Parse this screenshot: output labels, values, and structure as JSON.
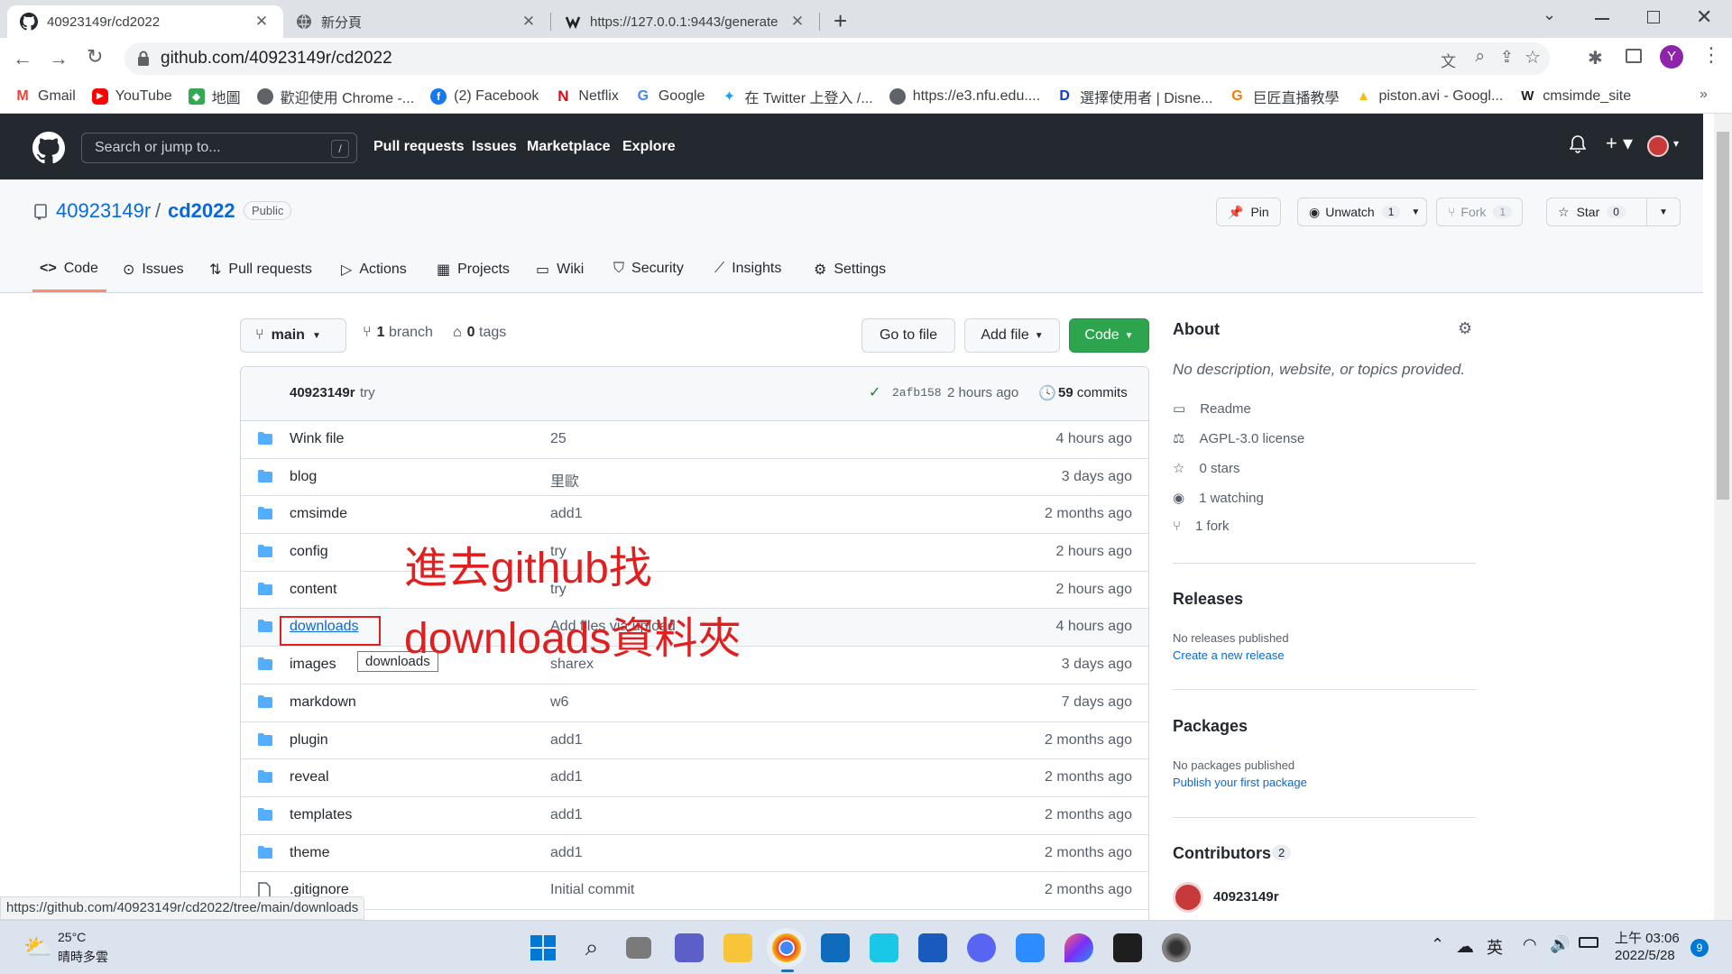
{
  "browser": {
    "tabs": [
      {
        "title": "40923149r/cd2022",
        "active": true
      },
      {
        "title": "新分頁",
        "active": false
      },
      {
        "title": "https://127.0.0.1:9443/generate",
        "active": false
      }
    ],
    "url": "github.com/40923149r/cd2022",
    "profile_initial": "Y",
    "bookmarks": [
      {
        "label": "Gmail",
        "icon": "gmail-icon",
        "color": "#ea4335"
      },
      {
        "label": "YouTube",
        "icon": "youtube-icon",
        "color": "#ff0000"
      },
      {
        "label": "地圖",
        "icon": "maps-icon",
        "color": "#34a853"
      },
      {
        "label": "歡迎使用 Chrome -...",
        "icon": "globe-icon",
        "color": "#5f6368"
      },
      {
        "label": "(2) Facebook",
        "icon": "facebook-icon",
        "color": "#1877f2"
      },
      {
        "label": "Netflix",
        "icon": "netflix-icon",
        "color": "#e50914"
      },
      {
        "label": "Google",
        "icon": "google-icon",
        "color": "#4285f4"
      },
      {
        "label": "在 Twitter 上登入 /...",
        "icon": "twitter-icon",
        "color": "#1da1f2"
      },
      {
        "label": "https://e3.nfu.edu....",
        "icon": "globe-icon",
        "color": "#5f6368"
      },
      {
        "label": "選擇使用者 | Disne...",
        "icon": "disney-icon",
        "color": "#113ccf"
      },
      {
        "label": "巨匠直播教學",
        "icon": "orange-g-icon",
        "color": "#f57c00"
      },
      {
        "label": "piston.avi - Googl...",
        "icon": "drive-icon",
        "color": "#fbbc04"
      },
      {
        "label": "cmsimde_site",
        "icon": "site-icon",
        "color": "#202124"
      }
    ],
    "status_url": "https://github.com/40923149r/cd2022/tree/main/downloads"
  },
  "github": {
    "search_placeholder": "Search or jump to...",
    "search_shortcut": "/",
    "nav": [
      "Pull requests",
      "Issues",
      "Marketplace",
      "Explore"
    ]
  },
  "repo": {
    "owner": "40923149r",
    "separator": "/",
    "name": "cd2022",
    "visibility": "Public",
    "pin_label": "Pin",
    "unwatch_label": "Unwatch",
    "unwatch_count": "1",
    "fork_label": "Fork",
    "fork_count": "1",
    "star_label": "Star",
    "star_count": "0",
    "tabs": [
      "Code",
      "Issues",
      "Pull requests",
      "Actions",
      "Projects",
      "Wiki",
      "Security",
      "Insights",
      "Settings"
    ]
  },
  "branchbar": {
    "branch": "main",
    "branches_count": "1",
    "branches_label": "branch",
    "tags_count": "0",
    "tags_label": "tags",
    "goto_file": "Go to file",
    "add_file": "Add file",
    "code": "Code"
  },
  "commit": {
    "author": "40923149r",
    "message": "try",
    "sha": "2afb158",
    "time": "2 hours ago",
    "commits_count": "59",
    "commits_label": "commits"
  },
  "files": [
    {
      "name": "Wink file",
      "message": "25",
      "time": "4 hours ago",
      "type": "dir"
    },
    {
      "name": "blog",
      "message": "里歐",
      "time": "3 days ago",
      "type": "dir"
    },
    {
      "name": "cmsimde",
      "message": "add1",
      "time": "2 months ago",
      "type": "dir"
    },
    {
      "name": "config",
      "message": "try",
      "time": "2 hours ago",
      "type": "dir"
    },
    {
      "name": "content",
      "message": "try",
      "time": "2 hours ago",
      "type": "dir"
    },
    {
      "name": "downloads",
      "message": "Add files via upload",
      "time": "4 hours ago",
      "type": "dir"
    },
    {
      "name": "images",
      "message": "sharex",
      "time": "3 days ago",
      "type": "dir"
    },
    {
      "name": "markdown",
      "message": "w6",
      "time": "7 days ago",
      "type": "dir"
    },
    {
      "name": "plugin",
      "message": "add1",
      "time": "2 months ago",
      "type": "dir"
    },
    {
      "name": "reveal",
      "message": "add1",
      "time": "2 months ago",
      "type": "dir"
    },
    {
      "name": "templates",
      "message": "add1",
      "time": "2 months ago",
      "type": "dir"
    },
    {
      "name": "theme",
      "message": "add1",
      "time": "2 months ago",
      "type": "dir"
    },
    {
      "name": ".gitignore",
      "message": "Initial commit",
      "time": "2 months ago",
      "type": "file"
    }
  ],
  "tooltip": "downloads",
  "annotation": {
    "line1": "進去github找",
    "line2": "downloads資料夾",
    "color": "#e02020"
  },
  "about": {
    "title": "About",
    "description": "No description, website, or topics provided.",
    "items": [
      {
        "icon": "book-icon",
        "label": "Readme"
      },
      {
        "icon": "scale-icon",
        "label": "AGPL-3.0 license"
      },
      {
        "icon": "star-icon",
        "label": "0 stars"
      },
      {
        "icon": "eye-icon",
        "label": "1 watching"
      },
      {
        "icon": "fork-icon",
        "label": "1 fork"
      }
    ],
    "releases_title": "Releases",
    "releases_none": "No releases published",
    "releases_link": "Create a new release",
    "packages_title": "Packages",
    "packages_none": "No packages published",
    "packages_link": "Publish your first package",
    "contributors_title": "Contributors",
    "contributors_count": "2",
    "contributor_name": "40923149r"
  },
  "taskbar": {
    "temperature": "25°C",
    "weather": "晴時多雲",
    "ime": "英",
    "time": "上午 03:06",
    "date": "2022/5/28",
    "notifications": "9"
  }
}
